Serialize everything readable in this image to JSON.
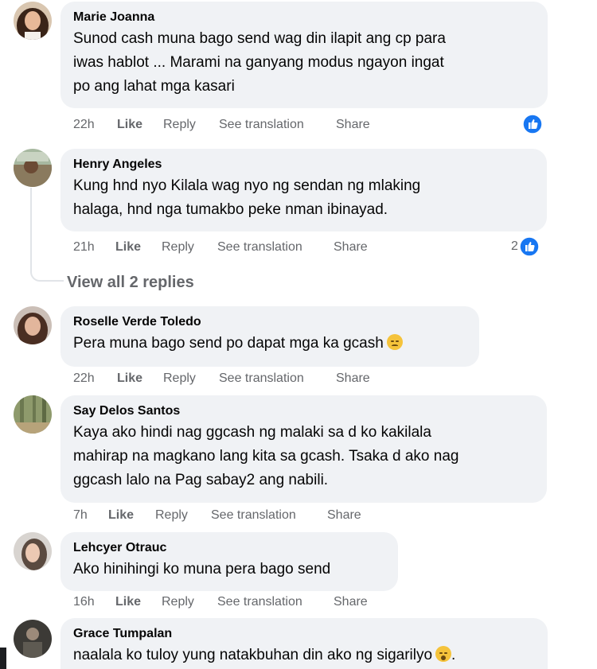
{
  "comments": [
    {
      "author": "Marie Joanna",
      "lines": [
        "Sunod cash muna bago send wag din ilapit ang cp para",
        "iwas hablot ... Marami na ganyang modus ngayon ingat",
        "po ang lahat mga kasari"
      ],
      "time": "22h",
      "like": "Like",
      "reply": "Reply",
      "see_translation": "See translation",
      "share": "Share",
      "reaction_count": ""
    },
    {
      "author": "Henry Angeles",
      "lines": [
        "Kung hnd nyo Kilala wag nyo ng sendan ng mlaking",
        "halaga, hnd nga tumakbo peke nman ibinayad."
      ],
      "time": "21h",
      "like": "Like",
      "reply": "Reply",
      "see_translation": "See translation",
      "share": "Share",
      "reaction_count": "2"
    },
    {
      "author": "Roselle Verde Toledo",
      "lines": [
        "Pera muna bago send po dapat mga ka gcash"
      ],
      "time": "22h",
      "like": "Like",
      "reply": "Reply",
      "see_translation": "See translation",
      "share": "Share",
      "reaction_count": ""
    },
    {
      "author": "Say Delos Santos",
      "lines": [
        "Kaya ako hindi nag ggcash ng malaki sa d ko kakilala",
        "mahirap na magkano lang kita sa gcash. Tsaka d ako nag",
        "ggcash lalo na Pag sabay2 ang nabili."
      ],
      "time": "7h",
      "like": "Like",
      "reply": "Reply",
      "see_translation": "See translation",
      "share": "Share",
      "reaction_count": ""
    },
    {
      "author": "Lehcyer Otrauc",
      "lines": [
        "Ako hinihingi ko muna pera bago send"
      ],
      "time": "16h",
      "like": "Like",
      "reply": "Reply",
      "see_translation": "See translation",
      "share": "Share",
      "reaction_count": ""
    },
    {
      "author": "Grace Tumpalan",
      "lines": [
        "naalala ko tuloy yung natakbuhan din ako ng sigarilyo"
      ],
      "time": "",
      "like": "",
      "reply": "",
      "see_translation": "",
      "share": "",
      "reaction_count": ""
    }
  ],
  "view_replies": "View all 2 replies",
  "icons": {
    "reaction": "like-reaction-icon",
    "sad": "sad-face-emoji-icon",
    "scream": "scream-face-emoji-icon"
  },
  "colors": {
    "bubble": "#f0f2f5",
    "secondary_text": "#65676b",
    "like_blue": "#1877f2"
  }
}
